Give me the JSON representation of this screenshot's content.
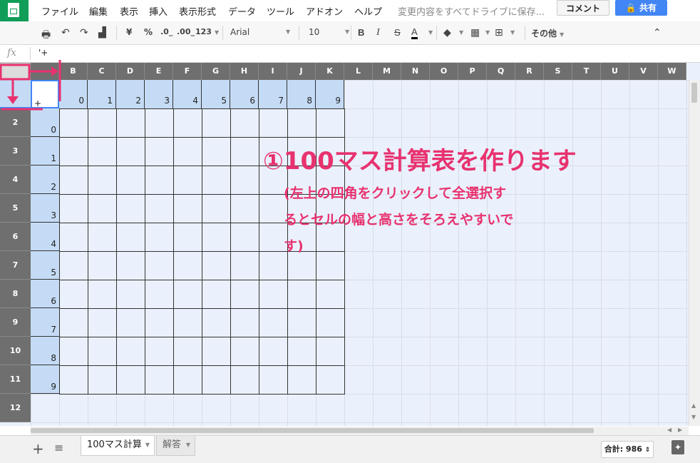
{
  "menu": {
    "items": [
      "ファイル",
      "編集",
      "表示",
      "挿入",
      "表示形式",
      "データ",
      "ツール",
      "アドオン",
      "ヘルプ"
    ],
    "save_status": "変更内容をすべてドライブに保存...",
    "comment_label": "コメント",
    "share_label": "共有"
  },
  "toolbar": {
    "currency": "¥",
    "percent": "%",
    "dec_decrease": ".0_",
    "dec_increase": ".00_",
    "format_more": "123",
    "font": "Arial",
    "font_size": "10",
    "bold": "B",
    "italic": "I",
    "strike": "S",
    "text_color": "A",
    "more": "その他"
  },
  "formula": {
    "fx": "fx",
    "value": "'+"
  },
  "grid": {
    "columns": [
      "B",
      "C",
      "D",
      "E",
      "F",
      "G",
      "H",
      "I",
      "J",
      "K",
      "L",
      "M",
      "N",
      "O",
      "P",
      "Q",
      "R",
      "S",
      "T",
      "U",
      "V",
      "W"
    ],
    "rows": [
      "2",
      "3",
      "4",
      "5",
      "6",
      "7",
      "8",
      "9",
      "10",
      "11",
      "12"
    ],
    "corner_cell": "+",
    "top_labels": [
      "0",
      "1",
      "2",
      "3",
      "4",
      "5",
      "6",
      "7",
      "8",
      "9"
    ],
    "side_labels": [
      "0",
      "1",
      "2",
      "3",
      "4",
      "5",
      "6",
      "7",
      "8",
      "9"
    ]
  },
  "sheets": {
    "tabs": [
      "100マス計算",
      "解答"
    ],
    "sum": "合計: 986"
  },
  "annotation": {
    "title": "①100マス計算表を作ります",
    "line1": "(左上の四角をクリックして全選択す",
    "line2": "るとセルの幅と高さをそろえやすいで",
    "line3": "す)"
  },
  "colors": {
    "accent": "#e8326f",
    "share": "#4285f4",
    "header": "#6f6f6f"
  }
}
